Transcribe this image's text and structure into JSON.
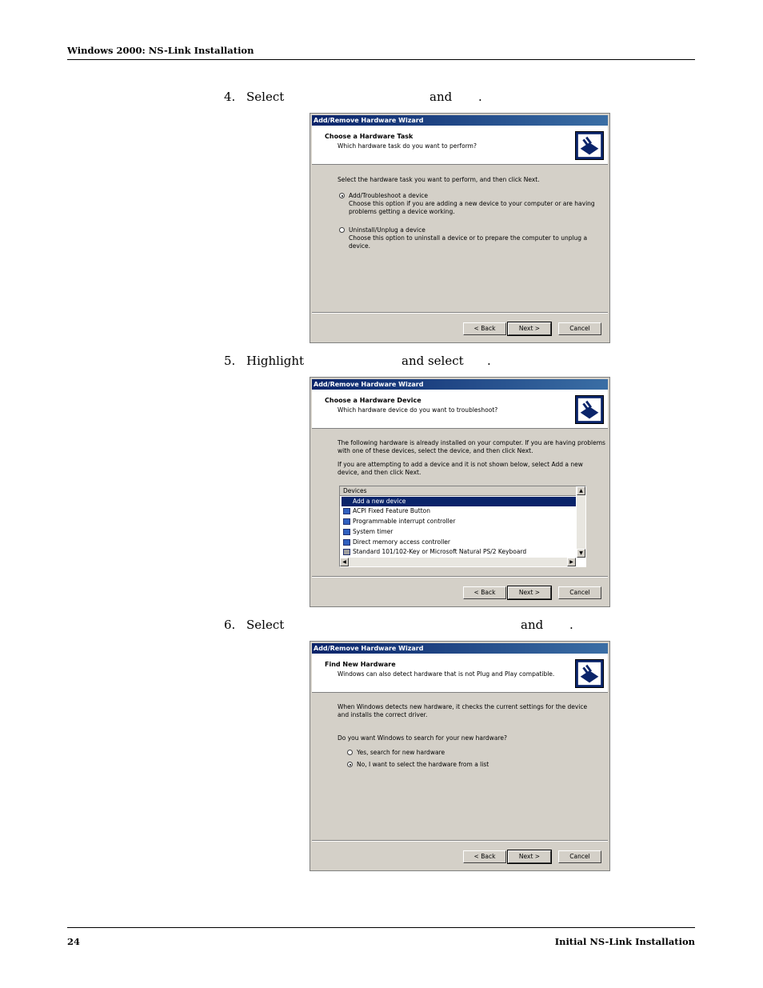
{
  "header": {
    "title": "Windows 2000: NS-Link Installation"
  },
  "footer": {
    "page_number": "24",
    "title": "Initial NS-Link Installation"
  },
  "steps": [
    {
      "number": "4.",
      "verb": "Select",
      "mid": "and",
      "end": "."
    },
    {
      "number": "5.",
      "verb": "Highlight",
      "mid": "and select",
      "end": "."
    },
    {
      "number": "6.",
      "verb": "Select",
      "mid": "and",
      "end": "."
    }
  ],
  "dialog1": {
    "title": "Add/Remove Hardware Wizard",
    "heading": "Choose a Hardware Task",
    "subheading": "Which hardware task do you want to perform?",
    "prompt": "Select the hardware task you want to perform, and then click Next.",
    "options": [
      {
        "label": "Add/Troubleshoot a device",
        "description": "Choose this option if you are adding a new device to your computer or are having\nproblems getting a device working.",
        "checked": true
      },
      {
        "label": "Uninstall/Unplug a device",
        "description": "Choose this option to uninstall a device or to prepare the computer to unplug a\ndevice.",
        "checked": false
      }
    ],
    "buttons": {
      "back": "< Back",
      "next": "Next >",
      "cancel": "Cancel"
    }
  },
  "dialog2": {
    "title": "Add/Remove Hardware Wizard",
    "heading": "Choose a Hardware Device",
    "subheading": "Which hardware device do you want to troubleshoot?",
    "paragraph1": "The following hardware is already installed on your computer. If you are having problems\nwith one of these devices, select the device, and then click Next.",
    "paragraph2": "If you are attempting to add a device and it is not shown below, select Add a new\ndevice, and then click Next.",
    "list_header": "Devices",
    "devices": [
      "Add a new device",
      "ACPI Fixed Feature Button",
      "Programmable interrupt controller",
      "System timer",
      "Direct memory access controller",
      "Standard 101/102-Key or Microsoft Natural PS/2 Keyboard"
    ],
    "selected_index": 0,
    "buttons": {
      "back": "< Back",
      "next": "Next >",
      "cancel": "Cancel"
    }
  },
  "dialog3": {
    "title": "Add/Remove Hardware Wizard",
    "heading": "Find New Hardware",
    "subheading": "Windows can also detect hardware that is not Plug and Play compatible.",
    "paragraph1": "When Windows detects new hardware, it checks the current settings for the device\nand installs the correct driver.",
    "question": "Do you want Windows to search for your new hardware?",
    "options": [
      {
        "label": "Yes, search for new hardware",
        "checked": false
      },
      {
        "label": "No, I want to select the hardware from a list",
        "checked": true
      }
    ],
    "buttons": {
      "back": "< Back",
      "next": "Next >",
      "cancel": "Cancel"
    }
  }
}
